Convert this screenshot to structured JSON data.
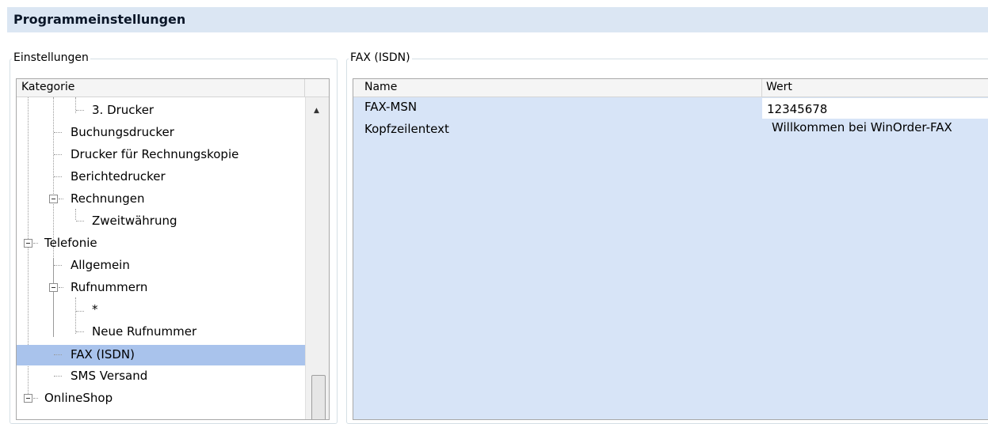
{
  "window": {
    "title": "Programmeinstellungen"
  },
  "left_panel": {
    "legend": "Einstellungen",
    "column_header": "Kategorie",
    "tree_items": [
      {
        "label": "3. Drucker"
      },
      {
        "label": "Buchungsdrucker"
      },
      {
        "label": "Drucker für Rechnungskopie"
      },
      {
        "label": "Berichtedrucker"
      },
      {
        "label": "Rechnungen"
      },
      {
        "label": "Zweitwährung"
      },
      {
        "label": "Telefonie"
      },
      {
        "label": "Allgemein"
      },
      {
        "label": "Rufnummern"
      },
      {
        "label": "*"
      },
      {
        "label": "Neue Rufnummer"
      },
      {
        "label": "FAX (ISDN)"
      },
      {
        "label": "SMS Versand"
      },
      {
        "label": "OnlineShop"
      }
    ],
    "selected_item": "FAX (ISDN)"
  },
  "right_panel": {
    "legend": "FAX (ISDN)",
    "columns": {
      "name": "Name",
      "value": "Wert"
    },
    "rows": [
      {
        "name": "FAX-MSN",
        "value": "12345678"
      },
      {
        "name": "Kopfzeilentext",
        "value": "Willkommen bei WinOrder-FAX"
      }
    ]
  },
  "colors": {
    "title_bar": "#dbe6f3",
    "selection": "#a9c3ec",
    "grid_background": "#d7e4f7"
  }
}
